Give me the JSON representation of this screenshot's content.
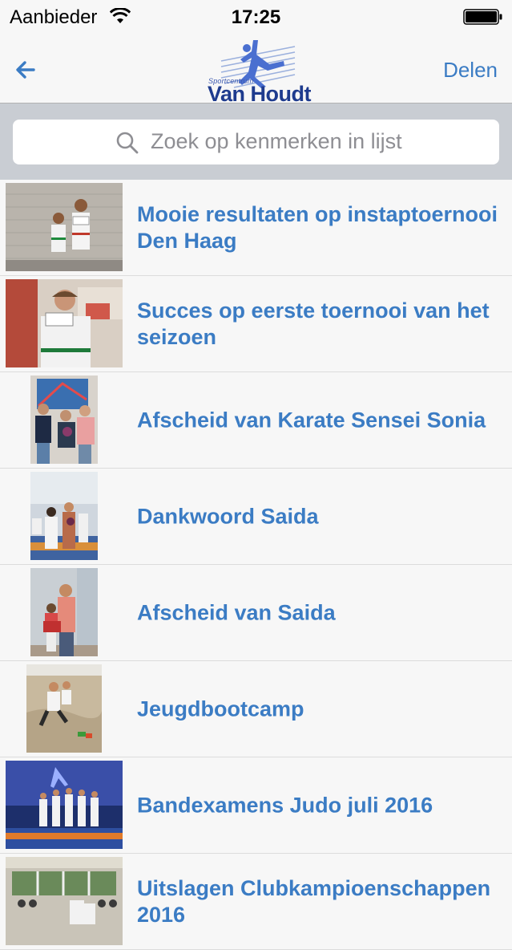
{
  "status_bar": {
    "carrier": "Aanbieder",
    "time": "17:25"
  },
  "nav": {
    "back_icon": "arrow-left-icon",
    "logo_small_text": "Sportcentrum",
    "logo_text": "Van Houdt",
    "share_label": "Delen"
  },
  "search": {
    "placeholder": "Zoek op kenmerken in lijst",
    "icon": "search-icon"
  },
  "colors": {
    "accent": "#3b7cc4",
    "bar_background": "#f7f7f7",
    "search_background": "#c9cdd3"
  },
  "items": [
    {
      "title": "Mooie resultaten op instaptoernooi Den Haag"
    },
    {
      "title": "Succes op eerste toernooi van het seizoen"
    },
    {
      "title": "Afscheid van Karate Sensei Sonia"
    },
    {
      "title": "Dankwoord Saida"
    },
    {
      "title": "Afscheid van Saida"
    },
    {
      "title": "Jeugdbootcamp"
    },
    {
      "title": "Bandexamens Judo juli 2016"
    },
    {
      "title": "Uitslagen Clubkampioenschappen 2016"
    }
  ]
}
